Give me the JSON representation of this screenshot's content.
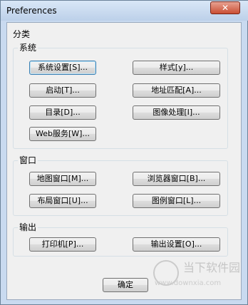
{
  "window": {
    "title": "Preferences",
    "close_symbol": "✕"
  },
  "categories_group": {
    "label": "分类"
  },
  "system_group": {
    "label": "系统",
    "buttons": [
      "系统设置[S]...",
      "样式[y]...",
      "启动[T]...",
      "地址匹配[A]...",
      "目录[D]...",
      "图像处理[I]...",
      "Web服务[W]..."
    ]
  },
  "window_group": {
    "label": "窗口",
    "buttons": [
      "地图窗口[M]...",
      "浏览器窗口[B]...",
      "布局窗口[U]...",
      "图例窗口[L]..."
    ]
  },
  "output_group": {
    "label": "输出",
    "buttons": [
      "打印机[P]...",
      "输出设置[O]..."
    ]
  },
  "footer": {
    "ok_label": "确定"
  },
  "watermark": {
    "logo_icon": "downxia-logo-icon",
    "brand_text": "当下软件园",
    "site_text": "www.downxia.com"
  }
}
